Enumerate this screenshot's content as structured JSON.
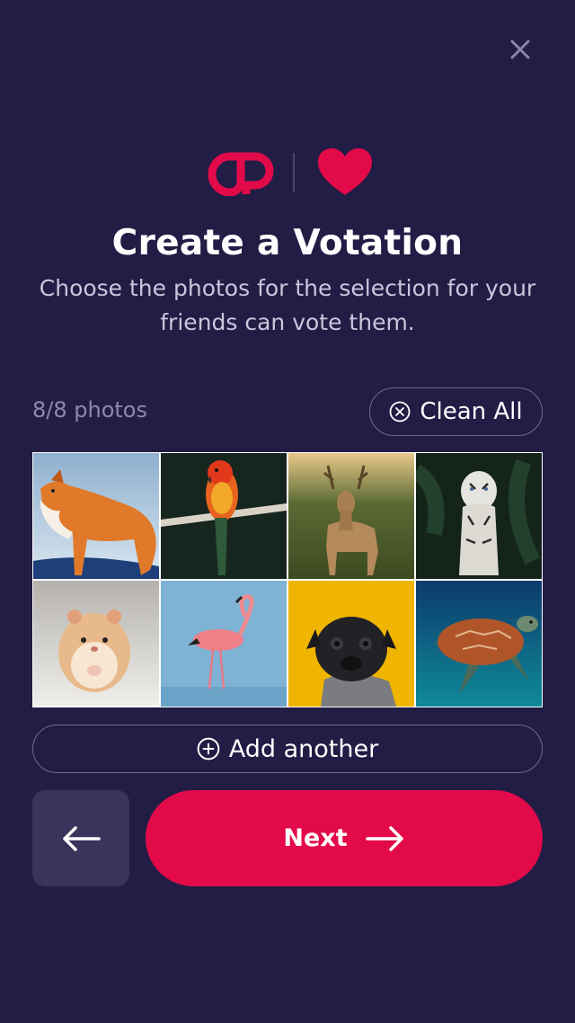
{
  "header": {
    "close_icon": "close-icon",
    "logo": "dp-logo",
    "heart_icon": "heart-icon"
  },
  "title": "Create a Votation",
  "subtitle": "Choose the photos for the selection for your friends can vote them.",
  "photos": {
    "count_label": "8/8 photos",
    "clean_all_label": "Clean All",
    "clean_icon": "circle-x-icon",
    "items": [
      {
        "name": "fox"
      },
      {
        "name": "parrot"
      },
      {
        "name": "deer"
      },
      {
        "name": "white-tiger"
      },
      {
        "name": "hamster"
      },
      {
        "name": "flamingo"
      },
      {
        "name": "pug"
      },
      {
        "name": "sea-turtle"
      }
    ]
  },
  "actions": {
    "add_another_label": "Add another",
    "add_icon": "circle-plus-icon",
    "back_icon": "arrow-left-icon",
    "next_label": "Next",
    "next_icon": "arrow-right-icon"
  },
  "colors": {
    "background": "#221d45",
    "accent": "#e30a4a",
    "muted_text": "#8d89a8",
    "secondary_button": "#3a345c"
  }
}
